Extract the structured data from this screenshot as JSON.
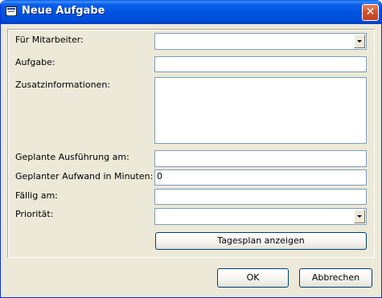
{
  "window": {
    "title": "Neue Aufgabe",
    "close_glyph": "✕",
    "icon": "form-icon"
  },
  "form": {
    "mitarbeiter": {
      "label": "Für Mitarbeiter:",
      "value": ""
    },
    "aufgabe": {
      "label": "Aufgabe:",
      "value": ""
    },
    "zusatz": {
      "label": "Zusatzinformationen:",
      "value": ""
    },
    "ausfuehrung": {
      "label": "Geplante Ausführung am:",
      "value": ""
    },
    "aufwand": {
      "label": "Geplanter Aufwand in Minuten:",
      "value": "0"
    },
    "faellig": {
      "label": "Fällig am:",
      "value": ""
    },
    "prioritaet": {
      "label": "Priorität:",
      "value": ""
    }
  },
  "buttons": {
    "tagesplan": "Tagesplan anzeigen",
    "ok": "OK",
    "abbrechen": "Abbrechen"
  }
}
